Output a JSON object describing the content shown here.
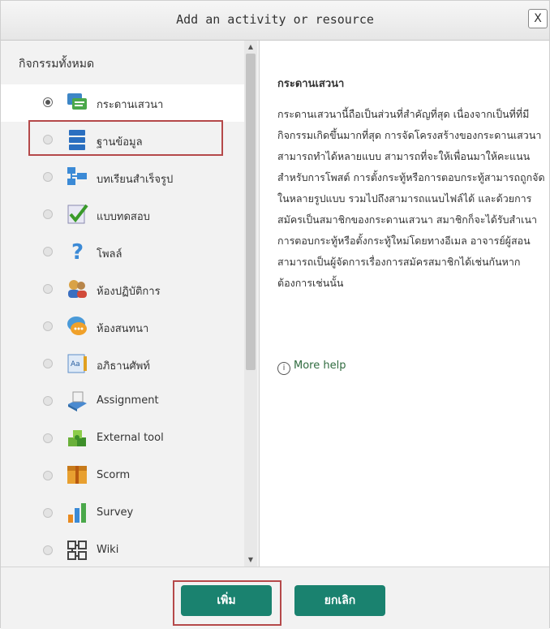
{
  "dialog": {
    "title": "Add an activity or resource",
    "close_label": "X"
  },
  "list": {
    "heading": "กิจกรรมทั้งหมด",
    "items": [
      {
        "label": "กระดานเสวนา",
        "icon": "forum-icon",
        "selected": true
      },
      {
        "label": "ฐานข้อมูล",
        "icon": "database-icon",
        "selected": false
      },
      {
        "label": "บทเรียนสำเร็จรูป",
        "icon": "lesson-icon",
        "selected": false
      },
      {
        "label": "แบบทดสอบ",
        "icon": "quiz-icon",
        "selected": false
      },
      {
        "label": "โพลล์",
        "icon": "choice-icon",
        "selected": false
      },
      {
        "label": "ห้องปฏิบัติการ",
        "icon": "workshop-icon",
        "selected": false
      },
      {
        "label": "ห้องสนทนา",
        "icon": "chat-icon",
        "selected": false
      },
      {
        "label": "อภิธานศัพท์",
        "icon": "glossary-icon",
        "selected": false
      },
      {
        "label": "Assignment",
        "icon": "assignment-icon",
        "selected": false
      },
      {
        "label": "External tool",
        "icon": "external-tool-icon",
        "selected": false
      },
      {
        "label": "Scorm",
        "icon": "scorm-icon",
        "selected": false
      },
      {
        "label": "Survey",
        "icon": "survey-icon",
        "selected": false
      },
      {
        "label": "Wiki",
        "icon": "wiki-icon",
        "selected": false
      }
    ]
  },
  "description": {
    "title": "กระดานเสวนา",
    "body": "กระดานเสวนานี้ถือเป็นส่วนที่สำคัญที่สุด เนื่องจากเป็นที่ที่มีกิจกรรมเกิดขึ้นมากที่สุด การจัดโครงสร้างของกระดานเสวนาสามารถทำได้หลายแบบ สามารถที่จะให้เพื่อนมาให้คะแนนสำหรับการโพสต์ การตั้งกระทู้หรือการตอบกระทู้สามารถถูกจัดในหลายรูปแบบ รวมไปถึงสามารถแนบไฟล์ได้ และด้วยการสมัครเป็นสมาชิกของกระดานเสวนา สมาชิกก็จะได้รับสำเนาการตอบกระทู้หรือตั้งกระทู้ใหม่โดยทางอีเมล อาจารย์ผู้สอนสามารถเป็นผู้จัดการเรื่องการสมัครสมาชิกได้เช่นกันหากต้องการเช่นนั้น",
    "more_help": "More help"
  },
  "footer": {
    "add_label": "เพิ่ม",
    "cancel_label": "ยกเลิก"
  },
  "colors": {
    "button": "#1a826f",
    "highlight": "#b5494a",
    "link": "#2f6b3f"
  }
}
